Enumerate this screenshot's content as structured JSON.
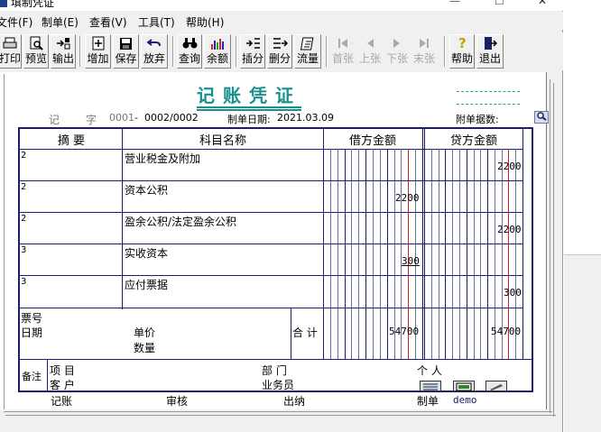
{
  "window": {
    "title": "填制凭证",
    "controls": {
      "minimize": "—",
      "maximize": "☐",
      "close": "✕"
    }
  },
  "menu": [
    {
      "label": "文件(F)"
    },
    {
      "label": "制单(E)"
    },
    {
      "label": "查看(V)"
    },
    {
      "label": "工具(T)"
    },
    {
      "label": "帮助(H)"
    }
  ],
  "toolbar": [
    {
      "label": "打印",
      "icon": "printer-icon",
      "enabled": true
    },
    {
      "label": "预览",
      "icon": "preview-icon",
      "enabled": true
    },
    {
      "label": "输出",
      "icon": "export-icon",
      "enabled": true
    },
    {
      "label": "增加",
      "icon": "add-icon",
      "enabled": true
    },
    {
      "label": "保存",
      "icon": "save-icon",
      "enabled": true
    },
    {
      "label": "放弃",
      "icon": "undo-icon",
      "enabled": true
    },
    {
      "label": "查询",
      "icon": "binoculars-icon",
      "enabled": true
    },
    {
      "label": "余额",
      "icon": "balance-chart-icon",
      "enabled": true
    },
    {
      "label": "插分",
      "icon": "insert-row-icon",
      "enabled": true
    },
    {
      "label": "删分",
      "icon": "delete-row-icon",
      "enabled": true
    },
    {
      "label": "流量",
      "icon": "cashflow-icon",
      "enabled": true
    },
    {
      "label": "首张",
      "icon": "first-icon",
      "enabled": false
    },
    {
      "label": "上张",
      "icon": "prev-icon",
      "enabled": false
    },
    {
      "label": "下张",
      "icon": "next-icon",
      "enabled": false
    },
    {
      "label": "末张",
      "icon": "last-icon",
      "enabled": false
    },
    {
      "label": "帮助",
      "icon": "help-icon",
      "enabled": true
    },
    {
      "label": "退出",
      "icon": "exit-icon",
      "enabled": true
    }
  ],
  "voucher": {
    "title": "记账凭证",
    "type_label": "记",
    "zi_label": "字",
    "number": "0001",
    "number_sep": "-",
    "page": "0002/0002",
    "date_label": "制单日期:",
    "date": "2021.03.09",
    "attach_label": "附单据数:",
    "columns": {
      "summary": "摘 要",
      "account": "科目名称",
      "debit": "借方金额",
      "credit": "贷方金额"
    },
    "rows": [
      {
        "summary": "2",
        "account": "营业税金及附加",
        "debit": "",
        "credit": "2200"
      },
      {
        "summary": "2",
        "account": "资本公积",
        "debit": "2200",
        "credit": ""
      },
      {
        "summary": "2",
        "account": "盈余公积/法定盈余公积",
        "debit": "",
        "credit": "2200"
      },
      {
        "summary": "3",
        "account": "实收资本",
        "debit": "300",
        "credit": ""
      },
      {
        "summary": "3",
        "account": "应付票据",
        "debit": "",
        "credit": "300"
      }
    ],
    "bill_no_label": "票号",
    "bill_date_label": "日期",
    "unit_price_label": "单价",
    "quantity_label": "数量",
    "total_label": "合 计",
    "total_debit": "54700",
    "total_credit": "54700",
    "remark_label": "备注",
    "project_label": "项  目",
    "dept_label": "部  门",
    "person_label": "个  人",
    "customer_label": "客  户",
    "salesman_label": "业务员"
  },
  "signatures": {
    "booking_label": "记账",
    "review_label": "审核",
    "cashier_label": "出纳",
    "maker_label": "制单",
    "maker": "demo"
  },
  "colors": {
    "grid": "#1c1c6e",
    "title": "#1a8f8f",
    "red_line": "#cc2222"
  }
}
